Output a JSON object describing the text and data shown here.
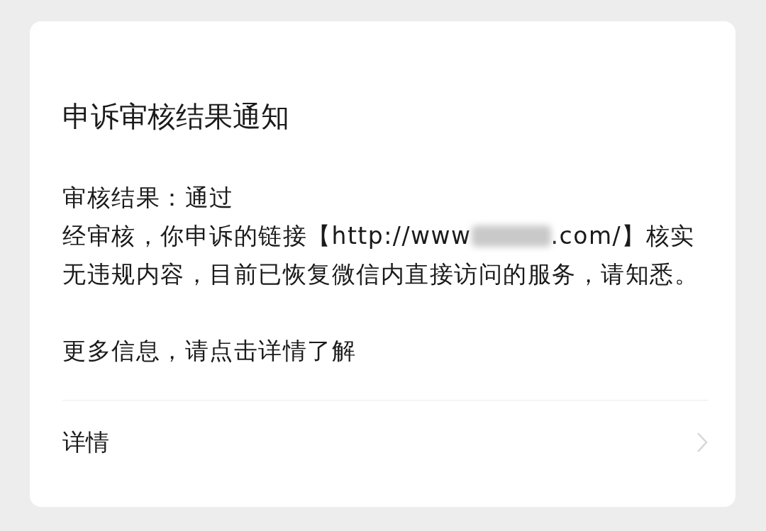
{
  "card": {
    "title": "申诉审核结果通知",
    "result_line": "审核结果：通过",
    "message": [
      {
        "kind": "text",
        "text": "经审核，你申诉的链接【http://www"
      },
      {
        "kind": "redacted"
      },
      {
        "kind": "text",
        "text": ".com/】核实无违规内容，目前已恢复微信内直接访问的服务，请知悉。"
      }
    ],
    "more_info": "更多信息，请点击详情了解",
    "details_link": "详情"
  }
}
